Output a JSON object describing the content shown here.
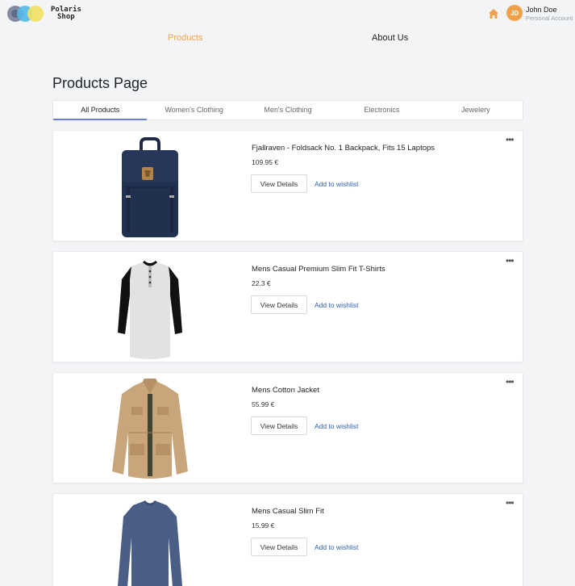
{
  "brand": {
    "line1": "Polaris",
    "line2": "Shop"
  },
  "user": {
    "initials": "JD",
    "name": "John Doe",
    "subtitle": "Personal Account"
  },
  "nav": {
    "products": "Products",
    "about": "About Us"
  },
  "page": {
    "title": "Products Page"
  },
  "tabs": [
    "All Products",
    "Women's Clothing",
    "Men's Clothing",
    "Electronics",
    "Jewelery"
  ],
  "active_tab": "All Products",
  "products": [
    {
      "name": "Fjallraven - Foldsack No. 1 Backpack, Fits 15 Laptops",
      "price": "109.95 €",
      "image_icon": "backpack-image"
    },
    {
      "name": "Mens Casual Premium Slim Fit T-Shirts",
      "price": "22.3 €",
      "image_icon": "tshirt-image"
    },
    {
      "name": "Mens Cotton Jacket",
      "price": "55.99 €",
      "image_icon": "jacket-image"
    },
    {
      "name": "Mens Casual Slim Fit",
      "price": "15.99 €",
      "image_icon": "longsleeve-image"
    }
  ],
  "card_actions": {
    "details": "View Details",
    "wishlist": "Add to wishlist",
    "more": "•••"
  },
  "colors": {
    "accent": "#f0a24a",
    "tab_indicator": "#6c7fd8",
    "link": "#2f5fa7",
    "background": "#f3f4f6"
  }
}
